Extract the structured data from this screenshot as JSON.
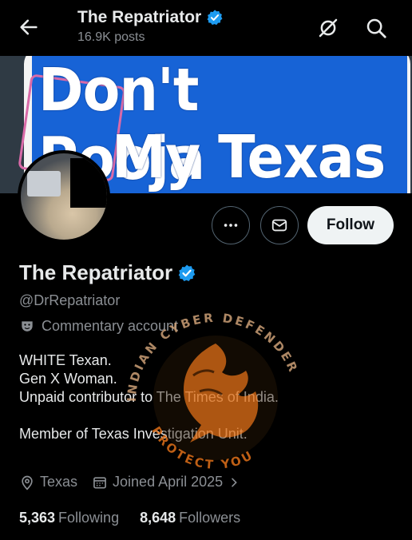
{
  "header": {
    "title": "The Repatriator",
    "posts": "16.9K posts"
  },
  "banner": {
    "line1": "Don't Pooja",
    "line2": "My Texas"
  },
  "actions": {
    "follow_label": "Follow"
  },
  "profile": {
    "name": "The Repatriator",
    "handle": "@DrRepatriator",
    "category": "Commentary account",
    "bio": [
      "WHITE Texan.",
      "Gen X Woman.",
      "Unpaid contributor to The Times of India.",
      "",
      "Member of Texas Investigation Unit."
    ],
    "location": "Texas",
    "joined": "Joined April 2025",
    "following_count": "5,363",
    "following_label": "Following",
    "followers_count": "8,648",
    "followers_label": "Followers"
  },
  "watermark": {
    "text_top": "INDIAN CYBER DEFENDER",
    "text_bottom": "PROTECT YOU"
  },
  "colors": {
    "verified": "#1d9bf0",
    "banner_blue": "#1763d6",
    "watermark_orange": "#e8741a"
  },
  "icons": [
    "back-arrow-icon",
    "verified-badge-icon",
    "spam-off-icon",
    "search-icon",
    "more-icon",
    "message-icon",
    "theater-masks-icon",
    "location-pin-icon",
    "calendar-icon",
    "chevron-right-icon"
  ]
}
